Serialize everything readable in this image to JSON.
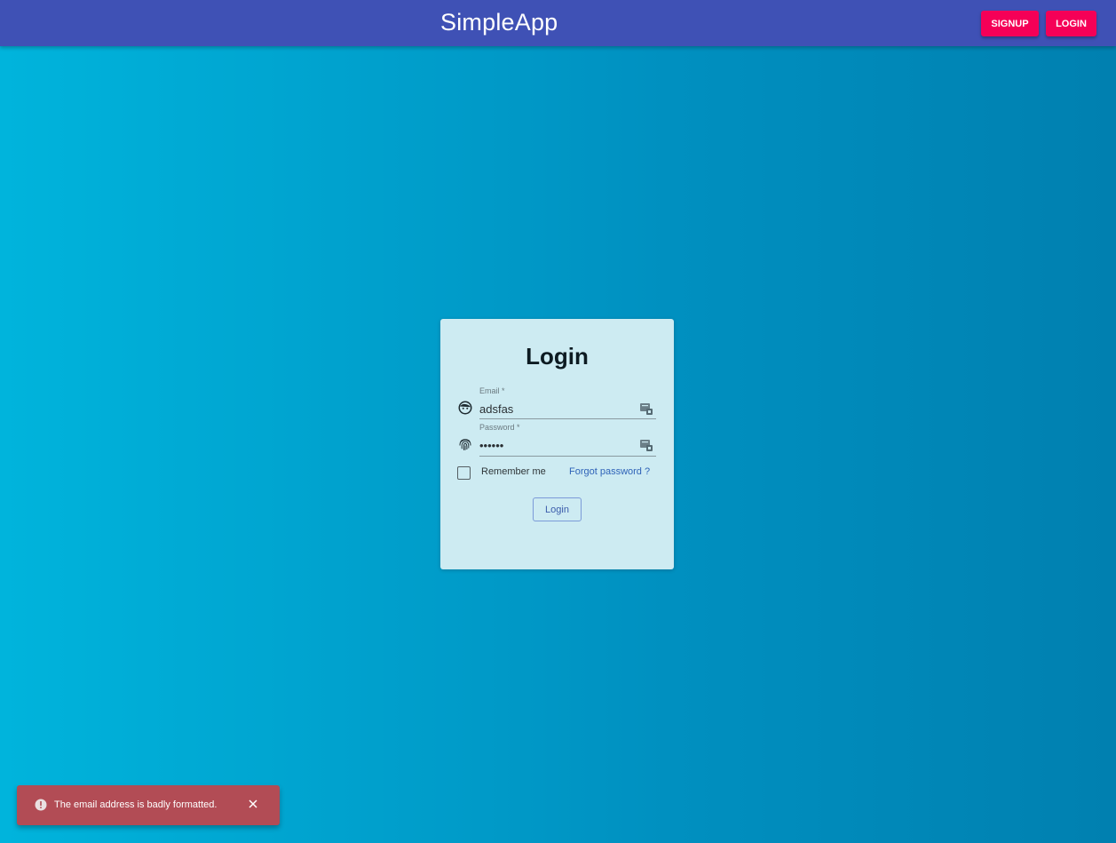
{
  "app": {
    "title": "SimpleApp",
    "signup_label": "SIGNUP",
    "login_label": "LOGIN"
  },
  "login_form": {
    "title": "Login",
    "email": {
      "label": "Email *",
      "value": "adsfas",
      "icon": "face-icon"
    },
    "password": {
      "label": "Password *",
      "value": "••••••",
      "icon": "fingerprint-icon"
    },
    "remember_label": "Remember me",
    "remember_checked": false,
    "forgot_label": "Forgot password ?",
    "submit_label": "Login"
  },
  "snackbar": {
    "message": "The email address is badly formatted.",
    "icon": "error-icon",
    "color": "#b24c55"
  },
  "colors": {
    "appbar": "#3f51b5",
    "accent": "#f50057",
    "card": "#cdebf2"
  }
}
